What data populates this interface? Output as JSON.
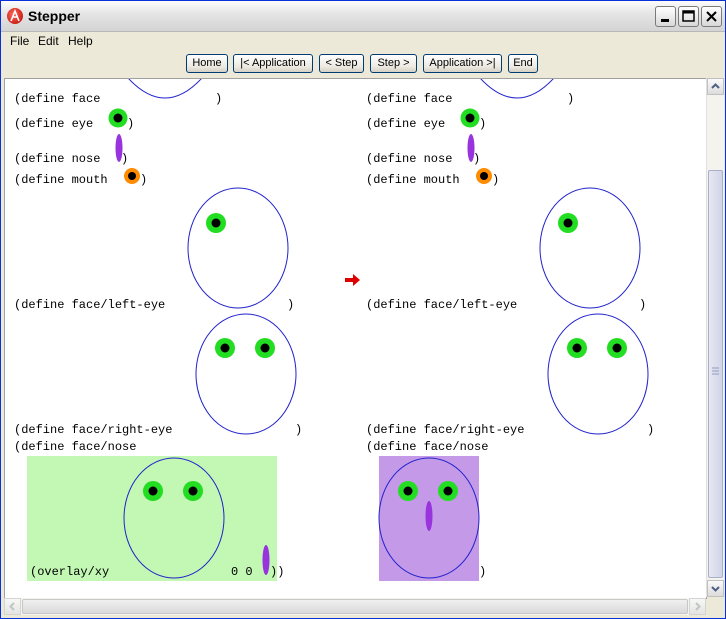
{
  "window": {
    "title": "Stepper"
  },
  "menu": {
    "file": "File",
    "edit": "Edit",
    "help": "Help"
  },
  "toolbar": {
    "home": "Home",
    "app_back": "|< Application",
    "step_back": "< Step",
    "step_fwd": "Step >",
    "app_fwd": "Application >|",
    "end": "End"
  },
  "left": {
    "face": "(define face",
    "face_close": ")",
    "eye": "(define eye",
    "eye_close": ")",
    "nose": "(define nose",
    "nose_close": ")",
    "mouth": "(define mouth",
    "mouth_close": ")",
    "left_eye": "(define face/left-eye",
    "left_eye_close": ")",
    "right_eye": "(define face/right-eye",
    "right_eye_close": ")",
    "face_nose": "(define face/nose",
    "overlay": "(overlay/xy",
    "overlay_args": "0 0",
    "overlay_close": "))"
  },
  "right": {
    "face": "(define face",
    "face_close": ")",
    "eye": "(define eye",
    "eye_close": ")",
    "nose": "(define nose",
    "nose_close": ")",
    "mouth": "(define mouth",
    "mouth_close": ")",
    "left_eye": "(define face/left-eye",
    "left_eye_close": ")",
    "right_eye": "(define face/right-eye",
    "right_eye_close": ")",
    "face_nose": "(define face/nose",
    "result_close": ")"
  },
  "colors": {
    "eye_ring": "#22dd22",
    "eye_pupil": "#000000",
    "nose": "#9933dd",
    "mouth_ring": "#ff8c00",
    "face_outline": "#2222cc",
    "highlight_green": "#c2f7b4",
    "highlight_purple": "#c49ae8",
    "step_arrow": "#dd0000"
  },
  "icons": {
    "app": "racket-logo-icon",
    "minimize": "minimize-icon",
    "maximize": "maximize-icon",
    "close": "close-icon",
    "step_arrow": "right-arrow-icon"
  }
}
